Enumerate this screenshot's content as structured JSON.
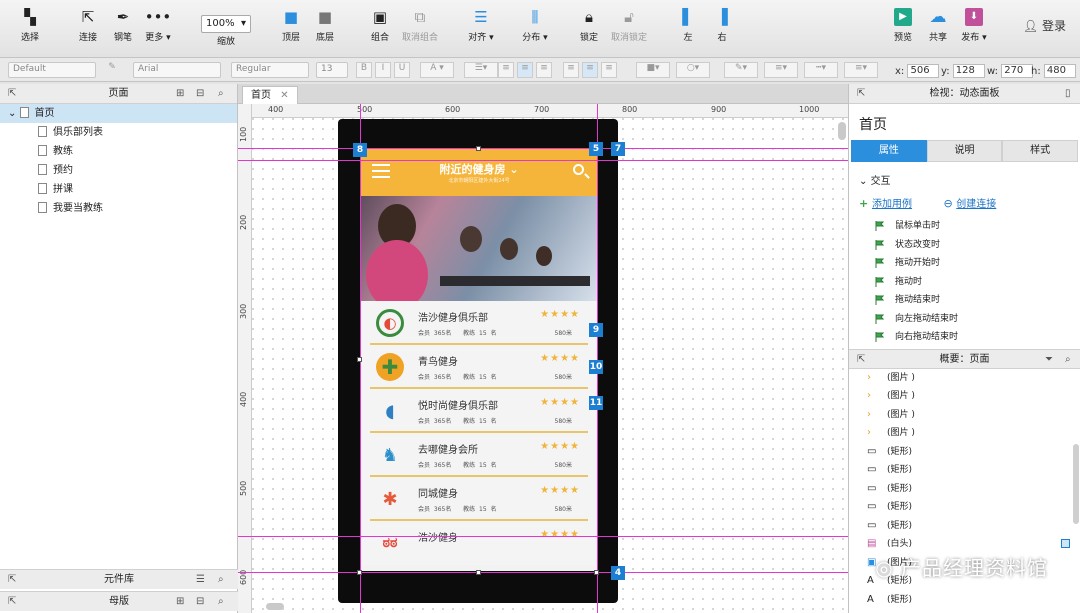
{
  "toolbar": {
    "tools": [
      {
        "id": "select",
        "label": "选择",
        "icon": "select-icon"
      },
      {
        "id": "connect",
        "label": "连接",
        "icon": "connect-icon"
      },
      {
        "id": "pen",
        "label": "钢笔",
        "icon": "pen-icon"
      },
      {
        "id": "more",
        "label": "更多 ▾",
        "icon": "more-icon"
      },
      {
        "id": "zoom",
        "label": "缩放"
      },
      {
        "id": "front",
        "label": "顶层",
        "icon": "bring-front-icon"
      },
      {
        "id": "back",
        "label": "底层",
        "icon": "send-back-icon"
      },
      {
        "id": "group",
        "label": "组合",
        "icon": "group-icon"
      },
      {
        "id": "ungroup",
        "label": "取消组合",
        "icon": "ungroup-icon"
      },
      {
        "id": "align",
        "label": "对齐 ▾",
        "icon": "align-icon"
      },
      {
        "id": "distribute",
        "label": "分布 ▾",
        "icon": "distribute-icon"
      },
      {
        "id": "lock",
        "label": "锁定",
        "icon": "lock-icon"
      },
      {
        "id": "unlock",
        "label": "取消锁定",
        "icon": "unlock-icon"
      },
      {
        "id": "left",
        "label": "左",
        "icon": "left-icon"
      },
      {
        "id": "right",
        "label": "右",
        "icon": "right-icon"
      },
      {
        "id": "preview",
        "label": "预览",
        "icon": "play-icon"
      },
      {
        "id": "share",
        "label": "共享",
        "icon": "cloud-icon"
      },
      {
        "id": "publish",
        "label": "发布 ▾",
        "icon": "publish-icon"
      }
    ],
    "zoom_value": "100%",
    "login": "登录"
  },
  "format": {
    "style": "Default",
    "font": "Arial",
    "weight": "Regular",
    "size": "13",
    "x_label": "x:",
    "x": "506",
    "y_label": "y:",
    "y": "128",
    "w_label": "w:",
    "w": "270",
    "h_label": "h:",
    "h": "480"
  },
  "left": {
    "pages_title": "页面",
    "root": "首页",
    "pages": [
      "俱乐部列表",
      "教练",
      "预约",
      "拼课",
      "我要当教练"
    ],
    "library_title": "元件库",
    "master_title": "母版"
  },
  "canvas": {
    "tab": "首页",
    "tab_close": "✕",
    "ruler_x": [
      "400",
      "500",
      "600",
      "700",
      "800",
      "900",
      "1000"
    ],
    "ruler_y": [
      "100",
      "200",
      "300",
      "400",
      "500",
      "600"
    ],
    "markers": [
      "8",
      "5",
      "7",
      "9",
      "10",
      "11",
      "4"
    ]
  },
  "app": {
    "title": "附近的健身房",
    "subtitle": "北京市朝阳区建外大街24号",
    "clubs": [
      {
        "name": "浩沙健身俱乐部",
        "members": "会员  365名",
        "coaches": "教练  15 名",
        "stars": "★★★★",
        "dist": "580米",
        "logo_color": "#3a8b3e",
        "icon": "leaf-logo-icon"
      },
      {
        "name": "青鸟健身",
        "members": "会员  365名",
        "coaches": "教练  15 名",
        "stars": "★★★★",
        "dist": "580米",
        "logo_color": "#f0a225",
        "icon": "plus-logo-icon"
      },
      {
        "name": "悦时尚健身俱乐部",
        "members": "会员  365名",
        "coaches": "教练  15 名",
        "stars": "★★★★",
        "dist": "580米",
        "logo_color": "#2f7fc5",
        "icon": "dolphin-logo-icon"
      },
      {
        "name": "去哪健身会所",
        "members": "会员  365名",
        "coaches": "教练  15 名",
        "stars": "★★★★",
        "dist": "580米",
        "logo_color": "#2d8fc9",
        "icon": "camel-logo-icon"
      },
      {
        "name": "同城健身",
        "members": "会员  365名",
        "coaches": "教练  15 名",
        "stars": "★★★★",
        "dist": "580米",
        "logo_color": "#e55a3b",
        "icon": "people-logo-icon"
      },
      {
        "name": "浩沙健身",
        "members": "",
        "coaches": "",
        "stars": "★★★★",
        "dist": "",
        "logo_color": "#e4473c",
        "icon": "red-logo-icon"
      }
    ]
  },
  "inspector": {
    "header": "检视：动态面板",
    "page_name": "首页",
    "tabs": [
      "属性",
      "说明",
      "样式"
    ],
    "interaction": "交互",
    "add_case": "添加用例",
    "create_link": "创建连接",
    "events": [
      "鼠标单击时",
      "状态改变时",
      "拖动开始时",
      "拖动时",
      "拖动结束时",
      "向左拖动结束时",
      "向右拖动结束时"
    ],
    "outline_title": "概要：页面",
    "outline": [
      {
        "icon": "›",
        "label": "(图片 )"
      },
      {
        "icon": "›",
        "label": "(图片 )"
      },
      {
        "icon": "›",
        "label": "(图片 )"
      },
      {
        "icon": "›",
        "label": "(图片 )"
      },
      {
        "icon": "▭",
        "label": "(矩形)"
      },
      {
        "icon": "▭",
        "label": "(矩形)"
      },
      {
        "icon": "▭",
        "label": "(矩形)"
      },
      {
        "icon": "▭",
        "label": "(矩形)"
      },
      {
        "icon": "▭",
        "label": "(矩形)"
      },
      {
        "icon": "▤",
        "label": "(白头)"
      },
      {
        "icon": "▣",
        "label": "(图片)"
      },
      {
        "icon": "A",
        "label": "(矩形)"
      },
      {
        "icon": "A",
        "label": "(矩形)"
      }
    ]
  },
  "watermark": "产品经理资料馆"
}
